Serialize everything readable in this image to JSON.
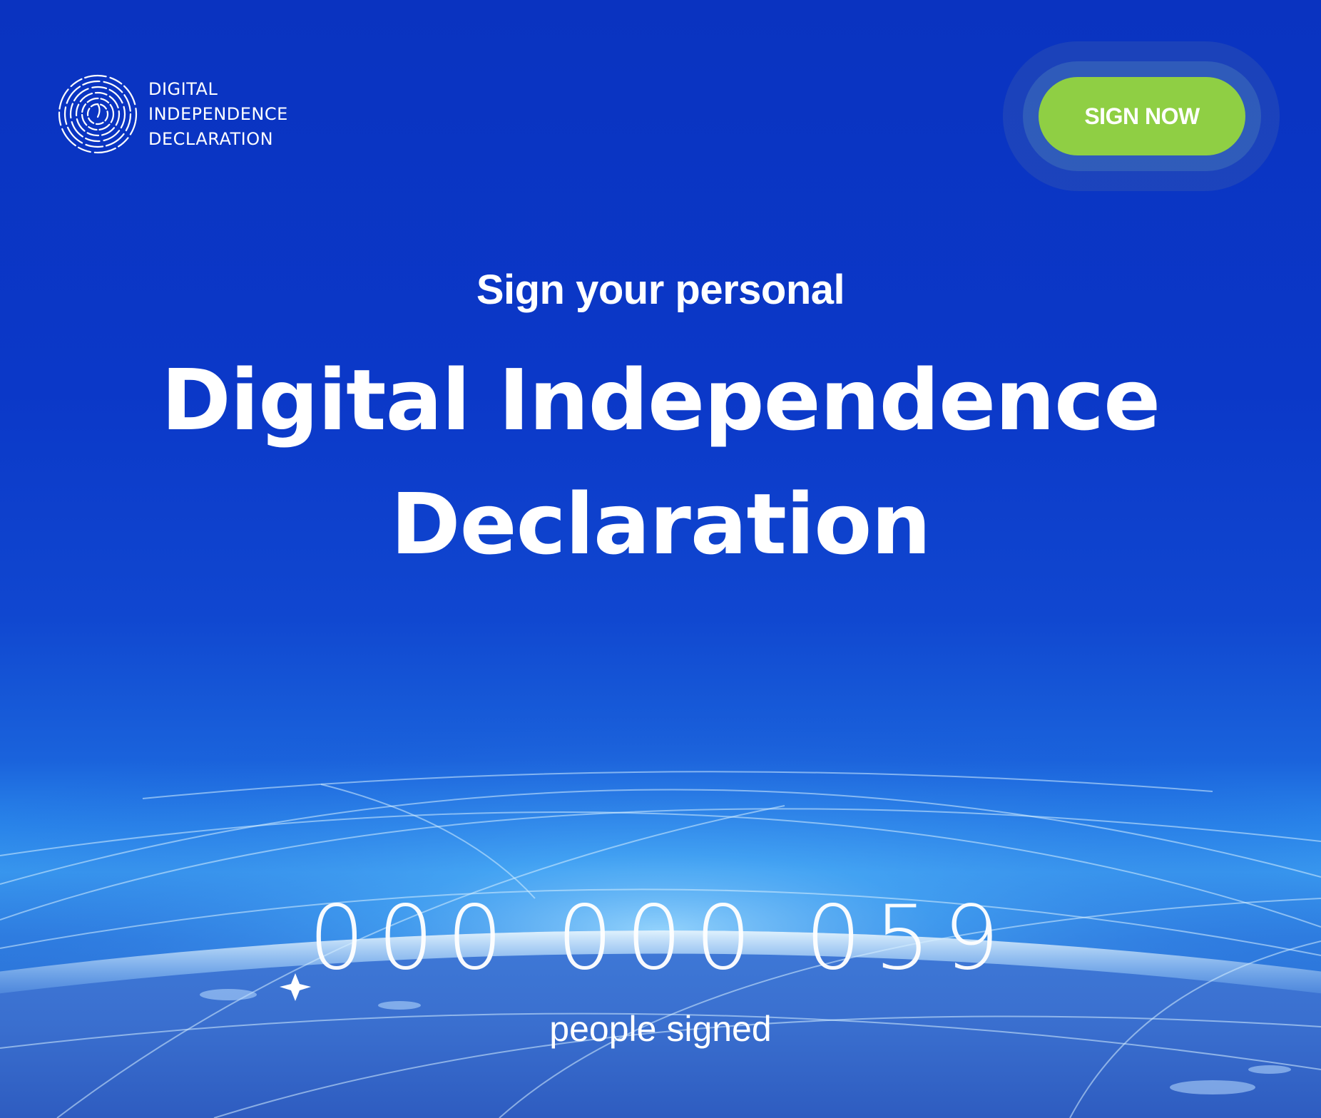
{
  "header": {
    "logo_lines": [
      "DIGITAL",
      "INDEPENDENCE",
      "DECLARATION"
    ],
    "logo_icon": "fingerprint-globe-icon",
    "cta_label": "SIGN NOW"
  },
  "hero": {
    "subtitle": "Sign your personal",
    "title_line1": "Digital Independence",
    "title_line2": "Declaration"
  },
  "counter": {
    "value": "000 000 059",
    "label": "people signed"
  },
  "colors": {
    "background": "#0a35c2",
    "cta": "#8fcf44",
    "text": "#ffffff"
  }
}
